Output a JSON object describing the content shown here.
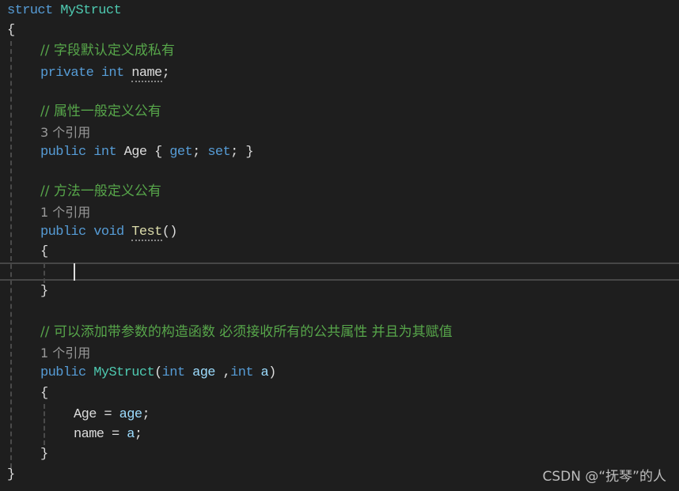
{
  "editor": {
    "lines": {
      "struct_kw": "struct",
      "struct_name": "MyStruct",
      "open_brace": "{",
      "close_brace": "}",
      "comment_field": "// 字段默认定义成私有",
      "private_kw": "private",
      "int_kw": "int",
      "field_name": "name",
      "semicolon": ";",
      "comment_property": "// 属性一般定义公有",
      "refs_property": "3 个引用",
      "public_kw": "public",
      "prop_name": "Age",
      "prop_open": "{",
      "get_kw": "get",
      "set_kw": "set",
      "prop_close": "}",
      "comment_method": "// 方法一般定义公有",
      "refs_method": "1 个引用",
      "void_kw": "void",
      "method_name": "Test",
      "method_parens": "()",
      "comment_ctor": "// 可以添加带参数的构造函数 必须接收所有的公共属性 并且为其赋值",
      "refs_ctor": "1 个引用",
      "ctor_name": "MyStruct",
      "ctor_open_paren": "(",
      "param_age": "age",
      "param_comma": " ,",
      "param_a": "a",
      "ctor_close_paren": ")",
      "assign_lhs_1": "Age",
      "assign_op": " = ",
      "assign_rhs_1": "age",
      "assign_lhs_2": "name",
      "assign_rhs_2": "a"
    }
  },
  "watermark": "CSDN @“抚琴”的人",
  "colors": {
    "background": "#1e1e1e",
    "keyword": "#569cd6",
    "type": "#4ec9b0",
    "comment": "#57a64a",
    "reference_lens": "#999999",
    "parameter": "#9cdcfe",
    "identifier": "#dcdcdc"
  }
}
